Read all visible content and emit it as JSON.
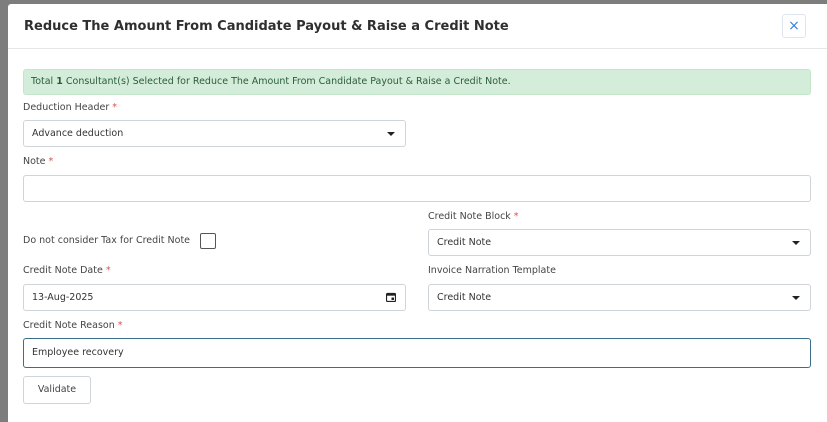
{
  "modal": {
    "title": "Reduce The Amount From Candidate Payout & Raise a Credit Note",
    "close_glyph": "×"
  },
  "alert": {
    "prefix": "Total",
    "count": "1",
    "suffix": "Consultant(s) Selected for Reduce The Amount From Candidate Payout & Raise a Credit Note."
  },
  "form": {
    "deduction_header": {
      "label": "Deduction Header",
      "required": "*",
      "value": "Advance deduction"
    },
    "note": {
      "label": "Note",
      "required": "*",
      "value": ""
    },
    "tax_checkbox": {
      "label": "Do not consider Tax for Credit Note",
      "checked": false
    },
    "credit_note_block": {
      "label": "Credit Note Block",
      "required": "*",
      "value": "Credit Note"
    },
    "credit_note_date": {
      "label": "Credit Note Date",
      "required": "*",
      "value": "13-Aug-2025"
    },
    "invoice_narration_template": {
      "label": "Invoice Narration Template",
      "value": "Credit Note"
    },
    "credit_note_reason": {
      "label": "Credit Note Reason",
      "required": "*",
      "value": "Employee recovery"
    }
  },
  "actions": {
    "validate_label": "Validate"
  },
  "colors": {
    "accent": "#3a80d6",
    "alert_bg": "#d4eddb",
    "required": "#d9534f"
  }
}
